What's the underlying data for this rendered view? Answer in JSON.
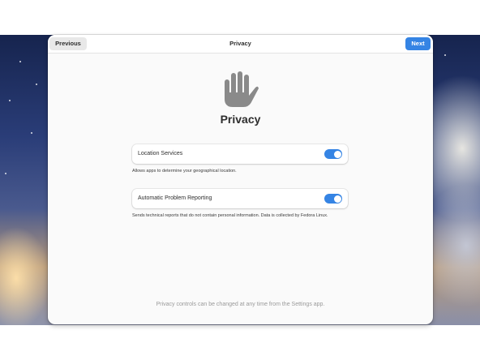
{
  "headerbar": {
    "previous_label": "Previous",
    "title": "Privacy",
    "next_label": "Next"
  },
  "page": {
    "icon": "hand-raised-icon",
    "heading": "Privacy"
  },
  "settings": [
    {
      "label": "Location Services",
      "enabled": true,
      "description": "Allows apps to determine your geographical location."
    },
    {
      "label": "Automatic Problem Reporting",
      "enabled": true,
      "description": "Sends technical reports that do not contain personal information. Data is collected by Fedora Linux."
    }
  ],
  "footer": {
    "note": "Privacy controls can be changed at any time from the Settings app."
  },
  "colors": {
    "accent": "#3584e4",
    "window_bg": "#fafafa",
    "icon_gray": "#8a8a8a"
  }
}
